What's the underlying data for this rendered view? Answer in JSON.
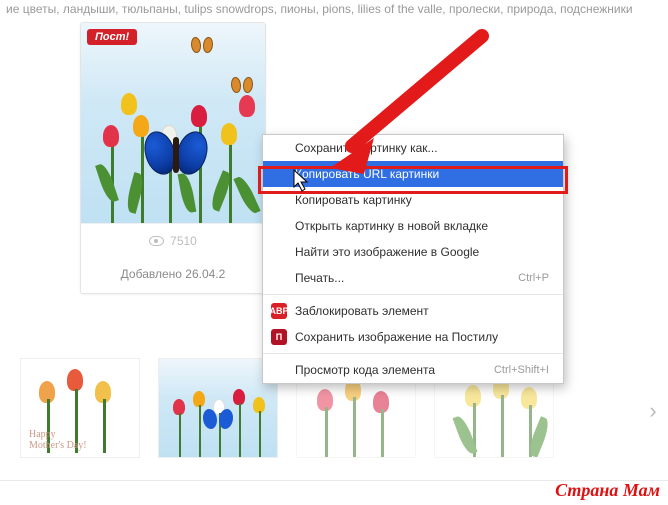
{
  "tags_line": "ие цветы, ландыши, тюльпаны, tulips snowdrops, пионы, pions, lilies of the valle, пролески, природа, подснежники",
  "card": {
    "badge": "Пост!",
    "views": "7510",
    "added_prefix": "Добавлено ",
    "added_date": "26.04.2"
  },
  "context_menu": {
    "save_image_as": "Сохранить картинку как...",
    "copy_image_url": "Копировать URL картинки",
    "copy_image": "Копировать картинку",
    "open_new_tab": "Открыть картинку в новой вкладке",
    "find_in_google": "Найти это изображение в Google",
    "print": "Печать...",
    "print_shortcut": "Ctrl+P",
    "abp_block": "Заблокировать элемент",
    "postila_save": "Сохранить изображение на Постилу",
    "inspect": "Просмотр кода элемента",
    "inspect_shortcut": "Ctrl+Shift+I",
    "abp_icon_label": "ABP",
    "postila_icon_glyph": "П"
  },
  "icons": {
    "eye": "views-eye",
    "chevron_right": "›"
  },
  "watermark": "Страна Мам"
}
